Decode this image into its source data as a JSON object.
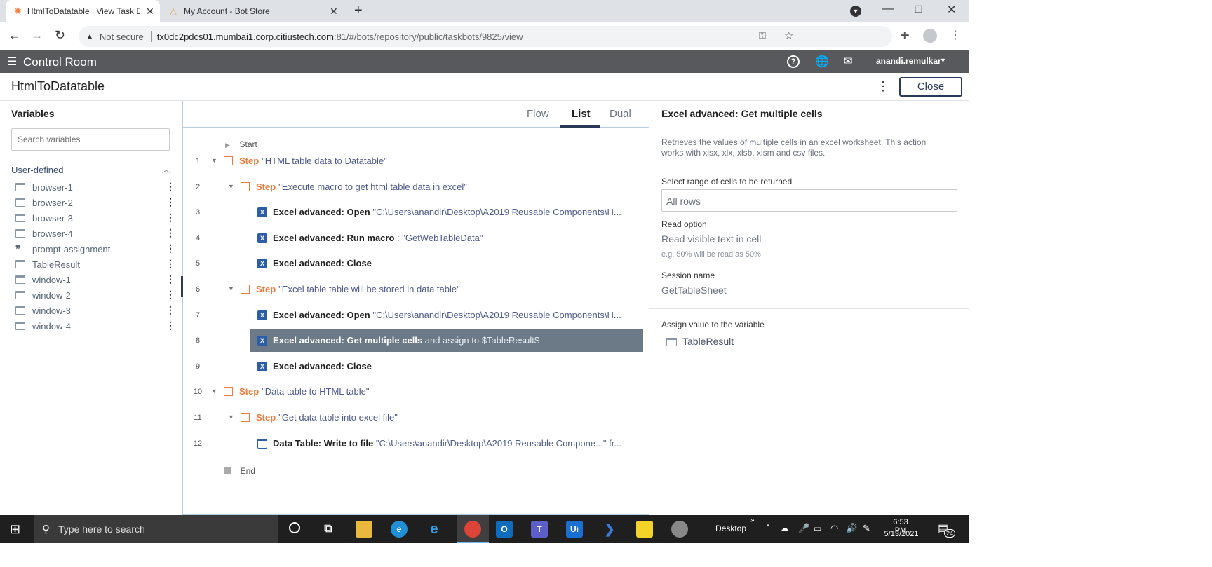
{
  "browser": {
    "tabs": [
      {
        "title": "HtmlToDatatable | View Task Bot",
        "active": true
      },
      {
        "title": "My Account - Bot Store",
        "active": false
      }
    ],
    "new_tab": "+",
    "security": "Not secure",
    "url_host": "tx0dc2pdcs01.mumbai1.corp.citiustech.com",
    "url_rest": ":81/#/bots/repository/public/taskbots/9825/view"
  },
  "app": {
    "name": "Control Room",
    "user": "anandi.remulkar"
  },
  "bot": {
    "title": "HtmlToDatatable",
    "close_label": "Close"
  },
  "variables": {
    "heading": "Variables",
    "search_placeholder": "Search variables",
    "group_label": "User-defined",
    "items": [
      {
        "name": "browser-1",
        "icon": "window-icon"
      },
      {
        "name": "browser-2",
        "icon": "window-icon"
      },
      {
        "name": "browser-3",
        "icon": "window-icon"
      },
      {
        "name": "browser-4",
        "icon": "window-icon"
      },
      {
        "name": "prompt-assignment",
        "icon": "quote-icon"
      },
      {
        "name": "TableResult",
        "icon": "table-icon"
      },
      {
        "name": "window-1",
        "icon": "window-icon"
      },
      {
        "name": "window-2",
        "icon": "window-icon"
      },
      {
        "name": "window-3",
        "icon": "window-icon"
      },
      {
        "name": "window-4",
        "icon": "window-icon"
      }
    ]
  },
  "view_tabs": [
    "Flow",
    "List",
    "Dual"
  ],
  "active_view": "List",
  "flow": {
    "start_label": "Start",
    "end_label": "End",
    "lines": [
      {
        "num": "1",
        "kind": "step",
        "keyword": "Step",
        "text": "\"HTML table data to Datatable\""
      },
      {
        "num": "2",
        "kind": "step",
        "keyword": "Step",
        "text": "\"Execute macro to get html table data in excel\""
      },
      {
        "num": "3",
        "kind": "action",
        "bold": "Excel advanced: Open",
        "rest": " \"C:\\Users\\anandir\\Desktop\\A2019 Reusable Components\\H..."
      },
      {
        "num": "4",
        "kind": "action",
        "bold": "Excel advanced: Run macro",
        "rest": " :  \"GetWebTableData\""
      },
      {
        "num": "5",
        "kind": "action",
        "bold": "Excel advanced: Close",
        "rest": ""
      },
      {
        "num": "6",
        "kind": "step",
        "keyword": "Step",
        "text": "\"Excel table table will be stored in data table\""
      },
      {
        "num": "7",
        "kind": "action",
        "bold": "Excel advanced: Open",
        "rest": " \"C:\\Users\\anandir\\Desktop\\A2019 Reusable Components\\H..."
      },
      {
        "num": "8",
        "kind": "action",
        "bold": "Excel advanced: Get multiple cells",
        "rest": " and assign to $TableResult$",
        "selected": true
      },
      {
        "num": "9",
        "kind": "action",
        "bold": "Excel advanced: Close",
        "rest": ""
      },
      {
        "num": "10",
        "kind": "step",
        "keyword": "Step",
        "text": "\"Data table to HTML table\""
      },
      {
        "num": "11",
        "kind": "step",
        "keyword": "Step",
        "text": "\"Get data table into excel file\""
      },
      {
        "num": "12",
        "kind": "action",
        "bold": "Data Table: Write to file",
        "rest": " \"C:\\Users\\anandir\\Desktop\\A2019 Reusable Compone...\" fr..."
      }
    ]
  },
  "details": {
    "title": "Excel advanced: Get multiple cells",
    "description": "Retrieves the values of multiple cells in an excel worksheet. This action works with xlsx, xlx, xlsb, xlsm and csv files.",
    "range_label": "Select range of cells to be returned",
    "range_value": "All rows",
    "read_option_label": "Read option",
    "read_option_value": "Read visible text in cell",
    "read_option_hint": "e.g. 50% will be read as 50%",
    "session_label": "Session name",
    "session_value": "GetTableSheet",
    "assign_label": "Assign value to the variable",
    "assign_value": "TableResult"
  },
  "taskbar": {
    "search_placeholder": "Type here to search",
    "desktop_label": "Desktop",
    "time": "6:53 PM",
    "date": "5/13/2021",
    "notification_count": "24"
  },
  "colors": {
    "step_orange": "#f07a3a",
    "selected_row": "#6b7a86",
    "header_gray": "#57595d",
    "excel_blue": "#2e5da8"
  }
}
